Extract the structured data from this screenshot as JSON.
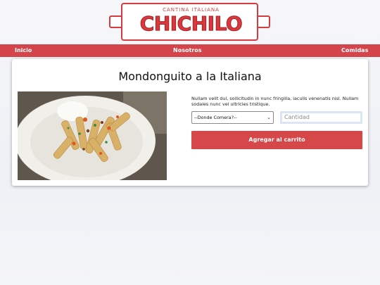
{
  "brand": {
    "tagline": "CANTINA ITALIANA",
    "name": "CHICHILO"
  },
  "nav": {
    "items": [
      "Inicio",
      "Nosotros",
      "Comidas"
    ]
  },
  "product": {
    "title": "Mondonguito a la Italiana",
    "description": "Nullam velit dui, sollicitudin in nunc fringilla, iaculis venenatis nisl. Nullam sodales nunc vel ultricies tristique.",
    "select_value": "--Donde Comera?--",
    "quantity_placeholder": "Cantidad",
    "add_to_cart_label": "Agregar al carrito"
  },
  "colors": {
    "brand_red": "#d3454a"
  }
}
